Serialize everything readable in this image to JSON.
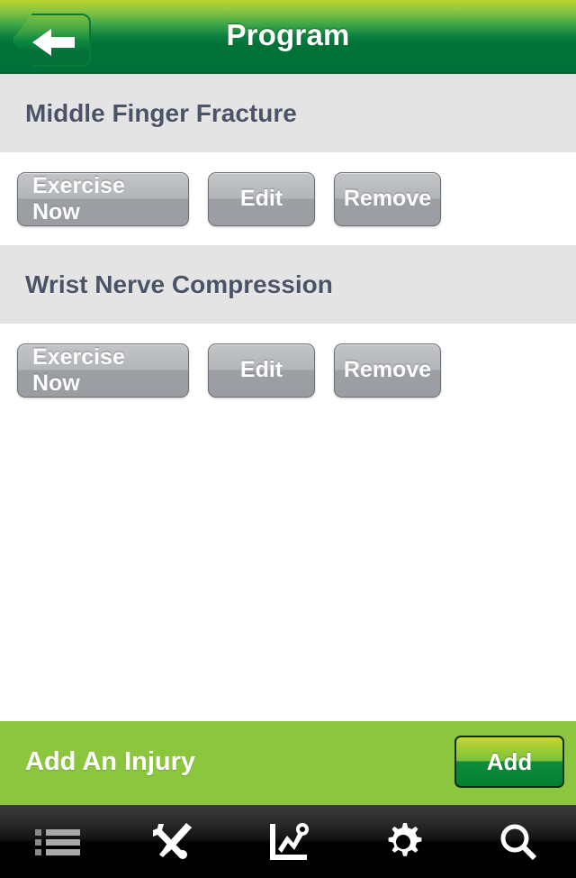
{
  "header": {
    "title": "Program",
    "back_icon": "arrow-left-icon"
  },
  "sections": [
    {
      "title": "Middle Finger Fracture",
      "actions": [
        {
          "label": "Exercise Now",
          "name": "exercise-now-button"
        },
        {
          "label": "Edit",
          "name": "edit-button"
        },
        {
          "label": "Remove",
          "name": "remove-button"
        }
      ]
    },
    {
      "title": "Wrist Nerve Compression",
      "actions": [
        {
          "label": "Exercise Now",
          "name": "exercise-now-button"
        },
        {
          "label": "Edit",
          "name": "edit-button"
        },
        {
          "label": "Remove",
          "name": "remove-button"
        }
      ]
    }
  ],
  "add_bar": {
    "label": "Add An Injury",
    "button_label": "Add"
  },
  "tab_bar": {
    "items": [
      {
        "icon": "list-icon",
        "active": true
      },
      {
        "icon": "tools-icon",
        "active": false
      },
      {
        "icon": "chart-icon",
        "active": false
      },
      {
        "icon": "gear-icon",
        "active": false
      },
      {
        "icon": "search-icon",
        "active": false
      }
    ]
  },
  "colors": {
    "header_top": "#b9d62e",
    "header_bottom": "#00703a",
    "section_band": "#e4e4e4",
    "section_text": "#4b5467",
    "add_bar": "#8cc63e",
    "tab_bar": "#000000",
    "tab_accent": "#8cc63e",
    "button_gray_top": "#c2c4c6",
    "button_gray_bottom": "#9a9da1"
  }
}
